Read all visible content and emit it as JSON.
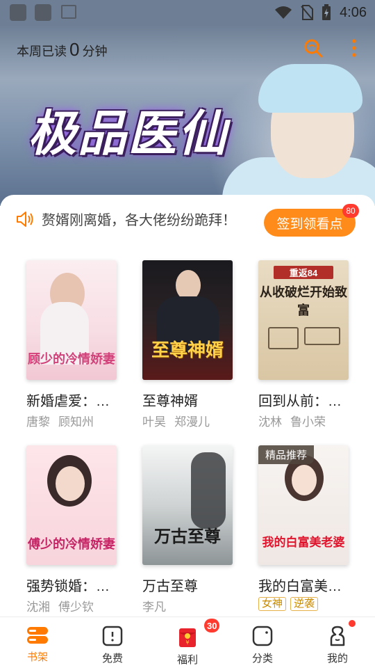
{
  "status_bar": {
    "time": "4:06"
  },
  "header": {
    "read_label": "本周已读",
    "read_minutes": "0",
    "read_unit": "分钟"
  },
  "banner": {
    "title": "极品医仙"
  },
  "notice": {
    "text": "赘婿刚离婚，各大佬纷纷跪拜！",
    "checkin_label": "签到领看点",
    "checkin_badge": "80"
  },
  "books": [
    {
      "title": "新婚虐爱：…",
      "authors": [
        "唐黎",
        "顾知州"
      ],
      "cover_text": "顾少的冷情娇妻",
      "cover_sub": "",
      "badge": ""
    },
    {
      "title": "至尊神婿",
      "authors": [
        "叶昊",
        "郑漫儿"
      ],
      "cover_text": "至尊神婿",
      "cover_sub": "",
      "badge": ""
    },
    {
      "title": "回到从前：…",
      "authors": [
        "沈林",
        "鲁小荣"
      ],
      "cover_text": "从收破烂开始致富",
      "cover_sub": "重返84",
      "badge": ""
    },
    {
      "title": "强势锁婚：…",
      "authors": [
        "沈湘",
        "傅少钦"
      ],
      "cover_text": "傅少的冷情娇妻",
      "cover_sub": "",
      "badge": ""
    },
    {
      "title": "万古至尊",
      "authors": [
        "李凡"
      ],
      "cover_text": "万古至尊",
      "cover_sub": "",
      "badge": ""
    },
    {
      "title": "我的白富美…",
      "authors": [],
      "tags": [
        "女神",
        "逆袭"
      ],
      "cover_text": "我的白富美老婆",
      "cover_sub": "",
      "badge": "精品推荐"
    }
  ],
  "nav": [
    {
      "label": "书架",
      "icon": "bookshelf-icon",
      "active": true
    },
    {
      "label": "免费",
      "icon": "free-book-icon",
      "active": false
    },
    {
      "label": "福利",
      "icon": "red-envelope-icon",
      "active": false,
      "badge": "30"
    },
    {
      "label": "分类",
      "icon": "category-icon",
      "active": false
    },
    {
      "label": "我的",
      "icon": "profile-icon",
      "active": false,
      "dot": true
    }
  ],
  "colors": {
    "accent": "#ff7a00",
    "badge": "#ff3b30",
    "muted": "#999999"
  }
}
